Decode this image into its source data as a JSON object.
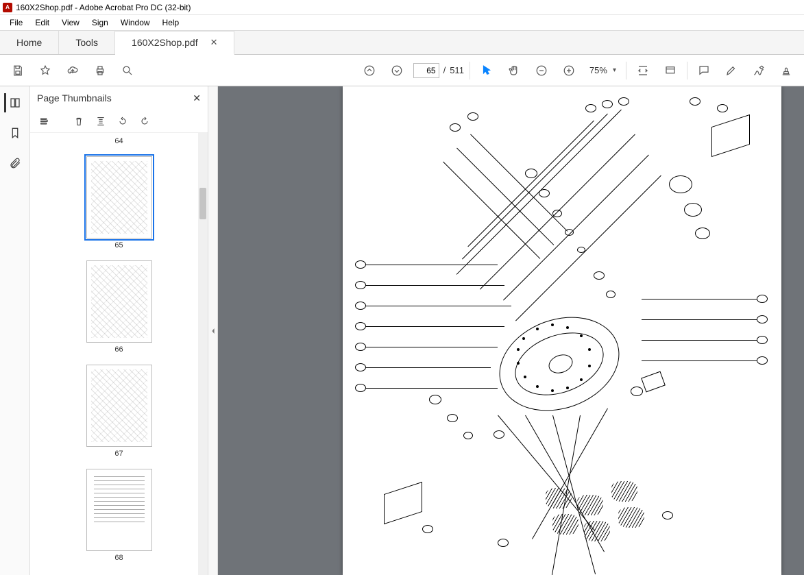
{
  "window": {
    "title": "160X2Shop.pdf - Adobe Acrobat Pro DC (32-bit)"
  },
  "menu": {
    "file": "File",
    "edit": "Edit",
    "view": "View",
    "sign": "Sign",
    "windowm": "Window",
    "help": "Help"
  },
  "tabs": {
    "home": "Home",
    "tools": "Tools",
    "doc": "160X2Shop.pdf"
  },
  "toolbar": {
    "page_current": "65",
    "page_sep": "/",
    "page_total": "511",
    "zoom_value": "75%"
  },
  "thumbnails": {
    "title": "Page Thumbnails",
    "prev_label": "64",
    "pages": [
      {
        "label": "65",
        "selected": true,
        "kind": "diagram"
      },
      {
        "label": "66",
        "selected": false,
        "kind": "diagram"
      },
      {
        "label": "67",
        "selected": false,
        "kind": "diagram"
      },
      {
        "label": "68",
        "selected": false,
        "kind": "text"
      }
    ]
  },
  "icons": {
    "save": "save-icon",
    "star": "star-icon",
    "cloud": "cloud-share-icon",
    "print": "print-icon",
    "find": "find-icon",
    "up": "page-up-icon",
    "down": "page-down-icon",
    "pointer": "pointer-icon",
    "hand": "hand-icon",
    "zoomout": "zoom-out-icon",
    "zoomin": "zoom-in-icon",
    "fit": "fit-width-icon",
    "read": "read-mode-icon",
    "comment": "comment-icon",
    "highlight": "highlight-icon",
    "sign": "draw-sign-icon",
    "stamp": "stamp-icon",
    "panel_thumbs": "thumbnails-panel-icon",
    "panel_bookmarks": "bookmark-panel-icon",
    "panel_attach": "attachments-panel-icon",
    "opts": "options-icon",
    "trash": "trash-icon",
    "layout": "layout-icon",
    "rotl": "rotate-ccw-icon",
    "rotr": "rotate-cw-icon"
  }
}
